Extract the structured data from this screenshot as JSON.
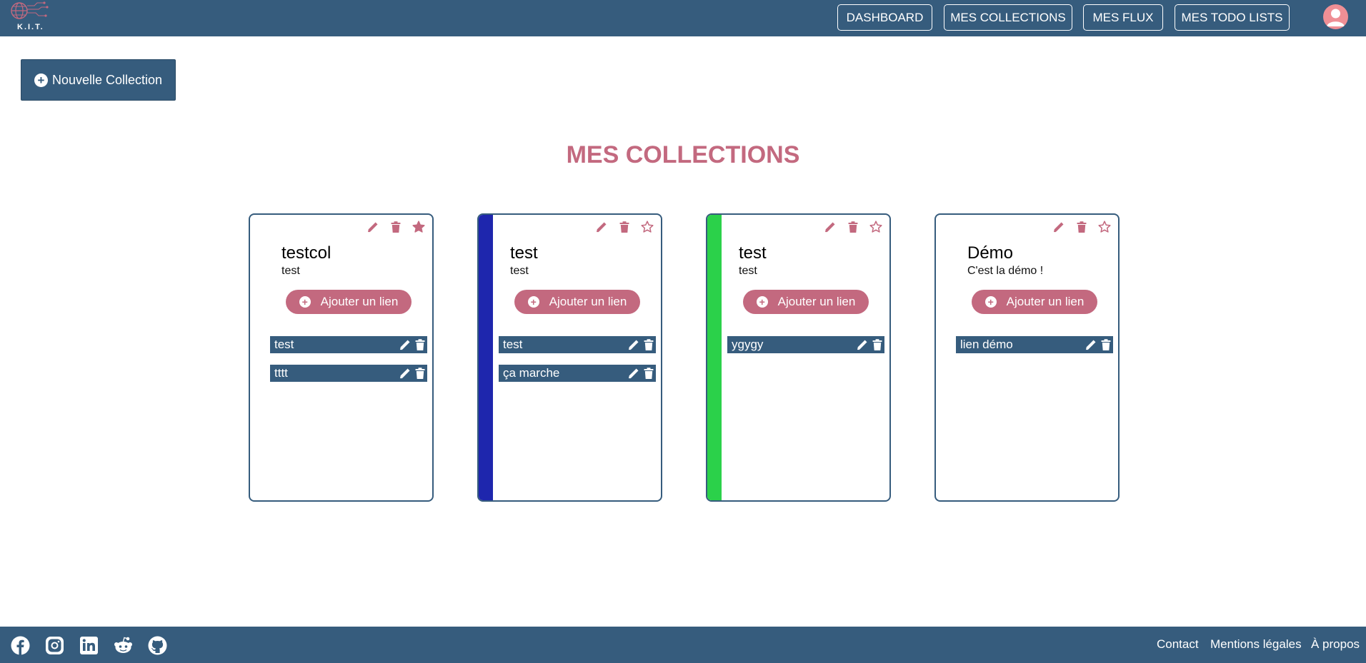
{
  "header": {
    "logo_text": "K.I.T.",
    "nav": [
      "DASHBOARD",
      "MES COLLECTIONS",
      "MES FLUX",
      "MES TODO LISTS"
    ]
  },
  "actions": {
    "new_collection": "Nouvelle Collection"
  },
  "page_title": "MES COLLECTIONS",
  "add_link_label": "Ajouter un lien",
  "collections": [
    {
      "title": "testcol",
      "description": "test",
      "color": "#ffffff",
      "favorite": true,
      "links": [
        "test",
        "tttt"
      ]
    },
    {
      "title": "test",
      "description": "test",
      "color": "#1e26ad",
      "favorite": false,
      "links": [
        "test",
        "ça marche"
      ]
    },
    {
      "title": "test",
      "description": "test",
      "color": "#2bd14a",
      "favorite": false,
      "links": [
        "ygygy"
      ]
    },
    {
      "title": "Démo",
      "description": "C'est la démo !",
      "color": "#ffffff",
      "favorite": false,
      "links": [
        "lien démo"
      ]
    }
  ],
  "footer": {
    "social": [
      "facebook-icon",
      "instagram-icon",
      "linkedin-icon",
      "reddit-icon",
      "github-icon"
    ],
    "links": [
      "Contact",
      "Mentions légales",
      "À propos"
    ]
  },
  "colors": {
    "primary": "#365c7d",
    "accent": "#c3697f",
    "avatar": "#ef8f95"
  }
}
